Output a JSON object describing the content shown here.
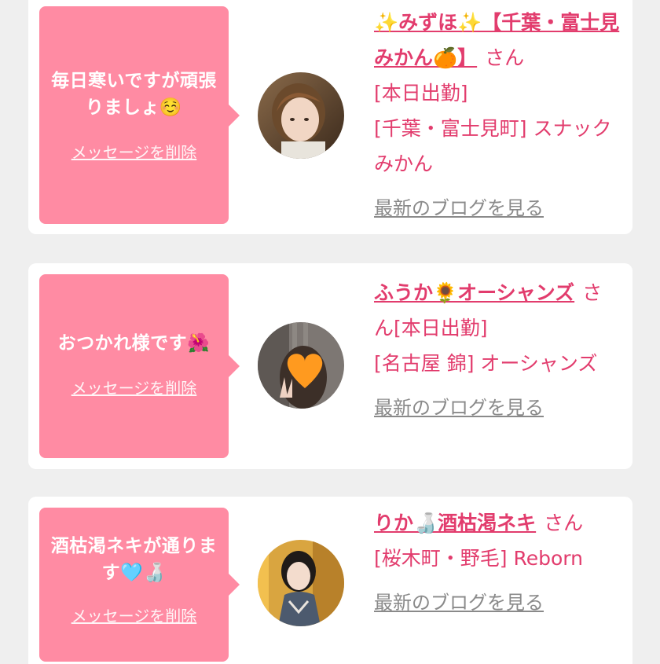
{
  "messages": [
    {
      "message_text": "毎日寒いですが頑張りましょ☺️",
      "delete_label": "メッセージを削除",
      "name": "✨みずほ✨【千葉・富士見みかん🍊】",
      "honorific": "さん",
      "status": "[本日出勤]",
      "shop": "[千葉・富士見町] スナックみかん",
      "blog_label": "最新のブログを見る"
    },
    {
      "message_text": "おつかれ様です🌺",
      "delete_label": "メッセージを削除",
      "name": "ふうか🌻オーシャンズ",
      "honorific": "さん",
      "status": "[本日出勤]",
      "shop": "[名古屋 錦] オーシャンズ",
      "blog_label": "最新のブログを見る"
    },
    {
      "message_text": "酒枯渇ネキが通ります🩵🍶",
      "delete_label": "メッセージを削除",
      "name": "りか🍶酒枯渇ネキ",
      "honorific": "さん",
      "status": "",
      "shop": "[桜木町・野毛] Reborn",
      "blog_label": "最新のブログを見る"
    }
  ],
  "colors": {
    "bubble": "#ff8ba3",
    "name": "#e23c6d",
    "link_gray": "#8a8a8a",
    "background": "#efefef"
  },
  "icons": [
    "avatar-photo"
  ]
}
